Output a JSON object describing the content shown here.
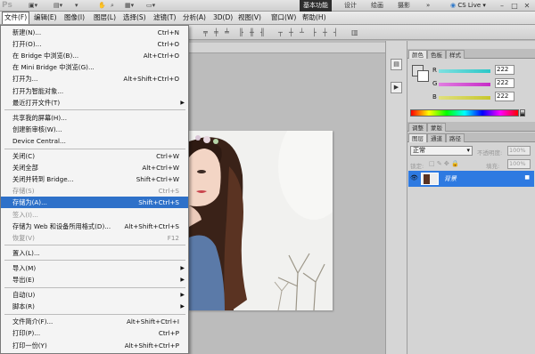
{
  "app": {
    "logo": "Ps"
  },
  "menubar": {
    "items": [
      "文件(F)",
      "编辑(E)",
      "图像(I)",
      "图层(L)",
      "选择(S)",
      "滤镜(T)",
      "分析(A)",
      "3D(D)",
      "视图(V)",
      "窗口(W)",
      "帮助(H)"
    ],
    "active": "文件(F)"
  },
  "workspace": {
    "buttons": [
      "基本功能",
      "设计",
      "绘画",
      "摄影"
    ],
    "active": "基本功能",
    "cs_live": "CS Live"
  },
  "file_menu": {
    "items": [
      {
        "label": "新建(N)...",
        "shortcut": "Ctrl+N",
        "disabled": false,
        "submenu": false,
        "highlight": false
      },
      {
        "label": "打开(O)...",
        "shortcut": "Ctrl+O",
        "disabled": false,
        "submenu": false,
        "highlight": false
      },
      {
        "label": "在 Bridge 中浏览(B)...",
        "shortcut": "Alt+Ctrl+O",
        "disabled": false,
        "submenu": false,
        "highlight": false
      },
      {
        "label": "在 Mini Bridge 中浏览(G)...",
        "shortcut": "",
        "disabled": false,
        "submenu": false,
        "highlight": false
      },
      {
        "label": "打开为...",
        "shortcut": "Alt+Shift+Ctrl+O",
        "disabled": false,
        "submenu": false,
        "highlight": false
      },
      {
        "label": "打开为智能对象...",
        "shortcut": "",
        "disabled": false,
        "submenu": false,
        "highlight": false
      },
      {
        "label": "最近打开文件(T)",
        "shortcut": "",
        "disabled": false,
        "submenu": true,
        "highlight": false
      },
      {
        "label": "共享我的屏幕(H)...",
        "shortcut": "",
        "disabled": false,
        "submenu": false,
        "highlight": false
      },
      {
        "label": "创建新审核(W)...",
        "shortcut": "",
        "disabled": false,
        "submenu": false,
        "highlight": false
      },
      {
        "label": "Device Central...",
        "shortcut": "",
        "disabled": false,
        "submenu": false,
        "highlight": false
      },
      {
        "label": "关闭(C)",
        "shortcut": "Ctrl+W",
        "disabled": false,
        "submenu": false,
        "highlight": false
      },
      {
        "label": "关闭全部",
        "shortcut": "Alt+Ctrl+W",
        "disabled": false,
        "submenu": false,
        "highlight": false
      },
      {
        "label": "关闭并转到 Bridge...",
        "shortcut": "Shift+Ctrl+W",
        "disabled": false,
        "submenu": false,
        "highlight": false
      },
      {
        "label": "存储(S)",
        "shortcut": "Ctrl+S",
        "disabled": true,
        "submenu": false,
        "highlight": false
      },
      {
        "label": "存储为(A)...",
        "shortcut": "Shift+Ctrl+S",
        "disabled": false,
        "submenu": false,
        "highlight": true
      },
      {
        "label": "签入(I)...",
        "shortcut": "",
        "disabled": true,
        "submenu": false,
        "highlight": false
      },
      {
        "label": "存储为 Web 和设备所用格式(D)...",
        "shortcut": "Alt+Shift+Ctrl+S",
        "disabled": false,
        "submenu": false,
        "highlight": false
      },
      {
        "label": "恢复(V)",
        "shortcut": "F12",
        "disabled": true,
        "submenu": false,
        "highlight": false
      },
      {
        "label": "置入(L)...",
        "shortcut": "",
        "disabled": false,
        "submenu": false,
        "highlight": false
      },
      {
        "label": "导入(M)",
        "shortcut": "",
        "disabled": false,
        "submenu": true,
        "highlight": false
      },
      {
        "label": "导出(E)",
        "shortcut": "",
        "disabled": false,
        "submenu": true,
        "highlight": false
      },
      {
        "label": "自动(U)",
        "shortcut": "",
        "disabled": false,
        "submenu": true,
        "highlight": false
      },
      {
        "label": "脚本(R)",
        "shortcut": "",
        "disabled": false,
        "submenu": true,
        "highlight": false
      },
      {
        "label": "文件简介(F)...",
        "shortcut": "Alt+Shift+Ctrl+I",
        "disabled": false,
        "submenu": false,
        "highlight": false
      },
      {
        "label": "打印(P)...",
        "shortcut": "Ctrl+P",
        "disabled": false,
        "submenu": false,
        "highlight": false
      },
      {
        "label": "打印一份(Y)",
        "shortcut": "Alt+Shift+Ctrl+P",
        "disabled": false,
        "submenu": false,
        "highlight": false
      }
    ],
    "separators_after": [
      6,
      9,
      17,
      18,
      20,
      22
    ]
  },
  "color_panel": {
    "tabs": [
      "颜色",
      "色板",
      "样式"
    ],
    "active_tab": "颜色",
    "channels": [
      {
        "name": "R",
        "value": "222"
      },
      {
        "name": "G",
        "value": "222"
      },
      {
        "name": "B",
        "value": "222"
      }
    ],
    "colors": {
      "fg": "#dedede",
      "r_slider": "#2cc7c7",
      "g_slider": "#c72cc7",
      "b_slider": "#c7c72c"
    }
  },
  "adjust_panel": {
    "tabs": [
      "调整",
      "蒙版"
    ]
  },
  "layers_panel": {
    "tabs": [
      "图层",
      "通道",
      "路径"
    ],
    "active_tab": "图层",
    "blend_mode": "正常",
    "opacity_label": "不透明度:",
    "opacity": "100%",
    "lock_label": "锁定:",
    "fill_label": "填充:",
    "fill": "100%",
    "layers": [
      {
        "name": "背景"
      }
    ]
  }
}
